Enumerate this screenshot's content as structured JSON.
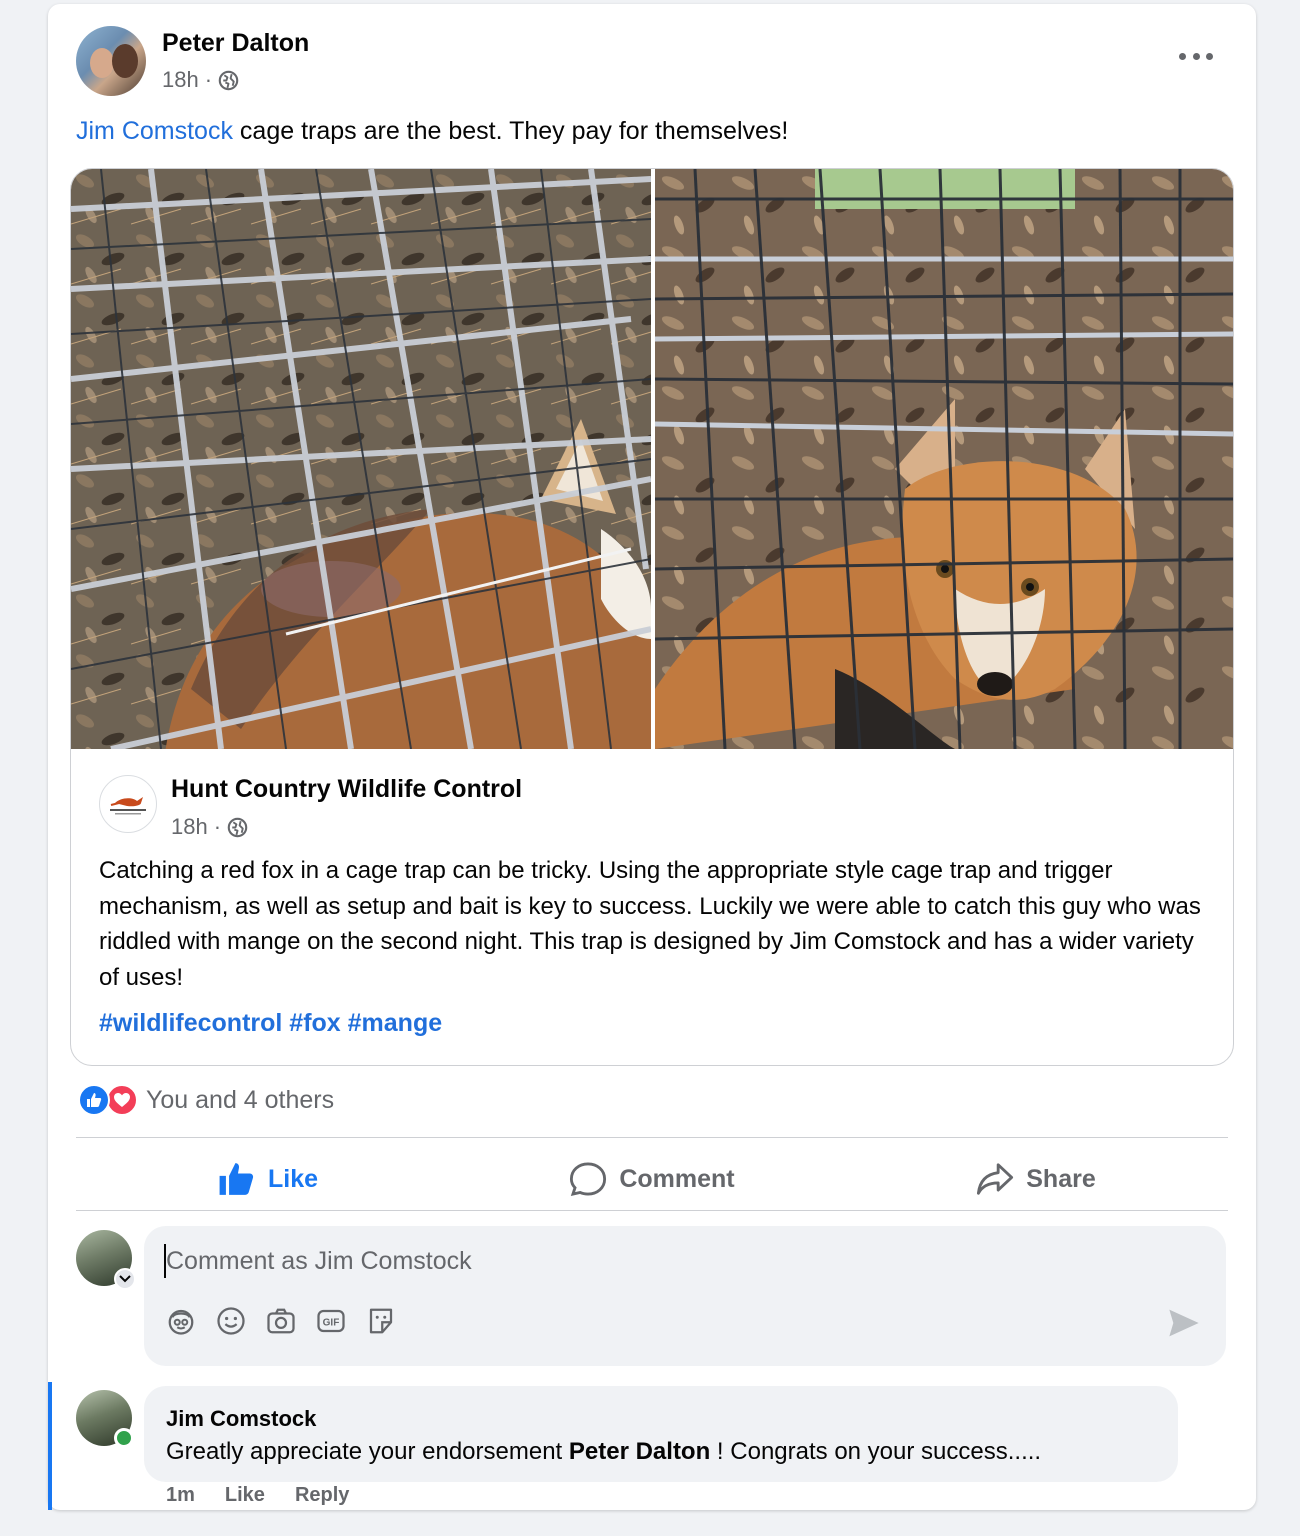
{
  "post": {
    "author": "Peter Dalton",
    "time": "18h",
    "separator": "·",
    "text_mention": "Jim Comstock",
    "text_rest": " cage traps are the best. They pay for themselves!"
  },
  "shared_post": {
    "page_name": "Hunt Country Wildlife Control",
    "page_logo_text": "HUNT COUNTRY",
    "time": "18h",
    "separator": "·",
    "body": "Catching a red fox in a cage trap can be tricky. Using the appropriate style cage trap and trigger mechanism, as well as setup and bait is key to success. Luckily we were able to catch this guy who was riddled with mange on the second night. This trap is designed by Jim Comstock and has a wider variety of uses!",
    "hashtags": "#wildlifecontrol #fox #mange"
  },
  "reactions": {
    "text": "You and 4 others",
    "types": [
      "like-icon",
      "love-icon"
    ]
  },
  "actions": {
    "like": "Like",
    "comment": "Comment",
    "share": "Share"
  },
  "composer": {
    "placeholder": "Comment as Jim Comstock",
    "tools": [
      "avatar-sticker-icon",
      "emoji-icon",
      "camera-icon",
      "gif-icon",
      "sticker-icon"
    ]
  },
  "comment": {
    "author": "Jim Comstock",
    "text_before": "Greatly appreciate your endorsement ",
    "mention": "Peter Dalton",
    "text_after": " ! Congrats on your success.....",
    "time": "1m",
    "like": "Like",
    "reply": "Reply"
  },
  "colors": {
    "accent": "#1877f2",
    "link": "#216fdb",
    "love": "#f33e58",
    "online": "#31a24c",
    "secondary_text": "#65676b"
  }
}
